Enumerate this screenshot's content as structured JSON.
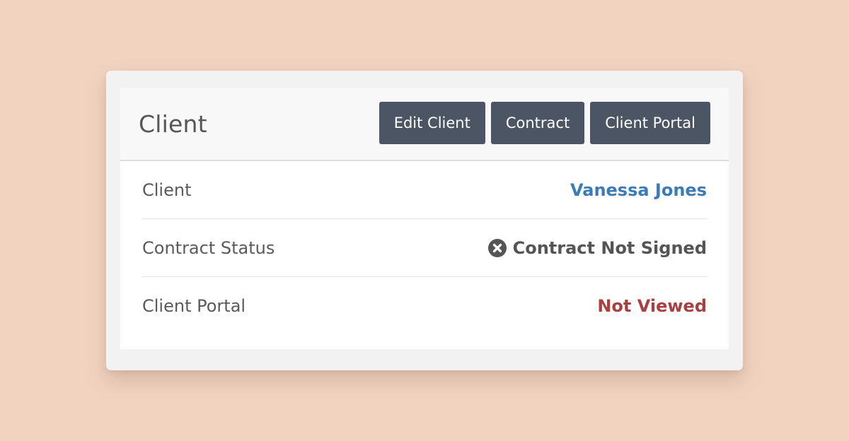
{
  "panel": {
    "title": "Client",
    "buttons": {
      "edit_client": "Edit Client",
      "contract": "Contract",
      "client_portal": "Client Portal"
    }
  },
  "rows": {
    "client": {
      "label": "Client",
      "value": "Vanessa Jones"
    },
    "contract_status": {
      "label": "Contract Status",
      "icon": "times-circle-icon",
      "value": "Contract Not Signed"
    },
    "client_portal": {
      "label": "Client Portal",
      "value": "Not Viewed"
    }
  },
  "colors": {
    "page_background": "#f2d3c0",
    "button_background": "#4b5563",
    "link": "#3b7bb6",
    "danger": "#a8403f",
    "muted_text": "#555555"
  }
}
